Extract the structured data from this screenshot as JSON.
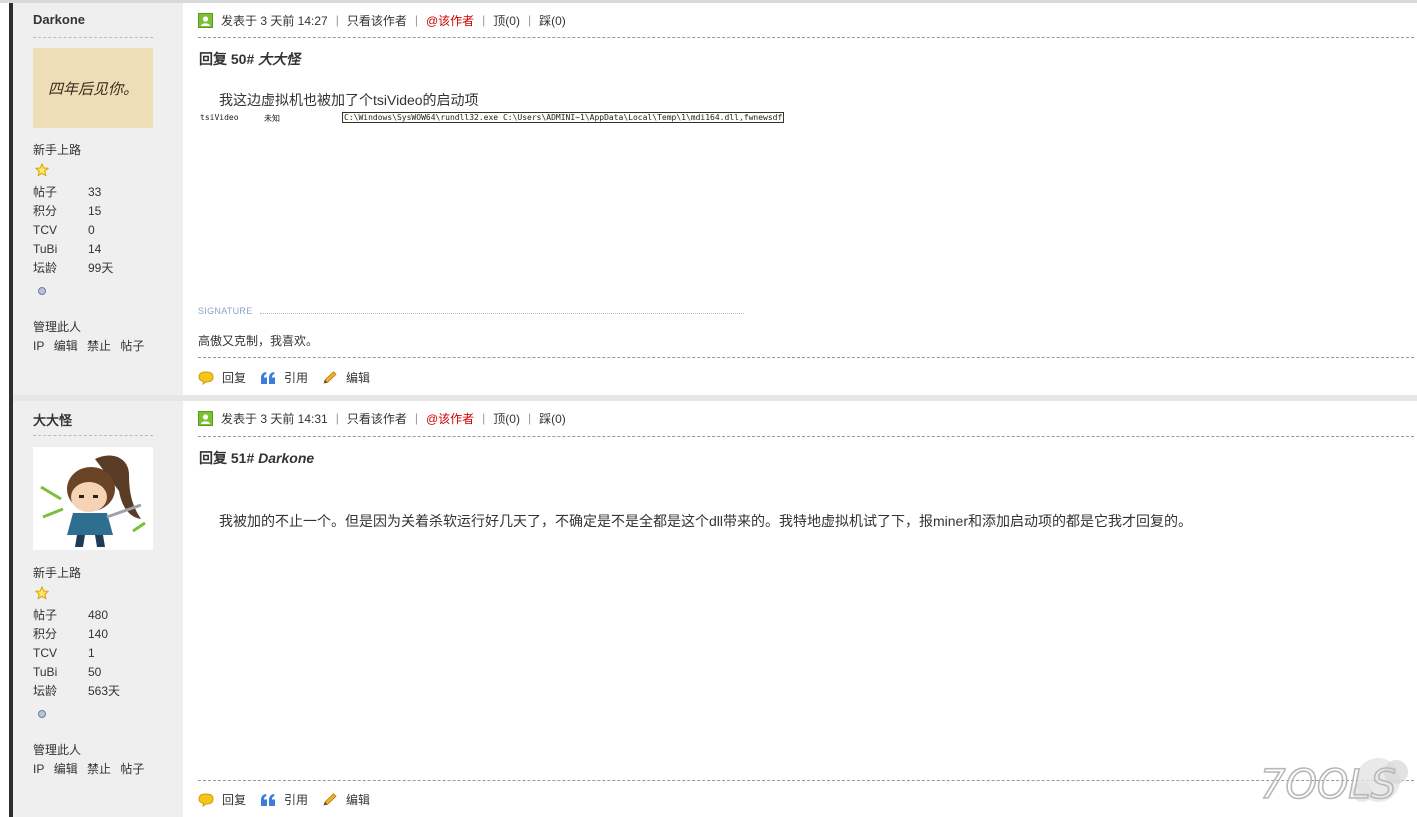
{
  "colors": {
    "sidebar_bg": "#efefef",
    "left_bar": "#2e2e2e",
    "red_link": "#cc0000",
    "signature_label": "#8aa4c8"
  },
  "posts": [
    {
      "author": "Darkone",
      "group": "新手上路",
      "stats": [
        {
          "k": "帖子",
          "v": "33"
        },
        {
          "k": "积分",
          "v": "15"
        },
        {
          "k": "TCV",
          "v": "0"
        },
        {
          "k": "TuBi",
          "v": "14"
        },
        {
          "k": "坛龄",
          "v": "99天"
        }
      ],
      "manage": "管理此人",
      "manage_links": [
        "IP",
        "编辑",
        "禁止",
        "帖子"
      ],
      "meta": {
        "posted": "发表于 3 天前 14:27",
        "only_author": "只看该作者",
        "at_author": "@该作者",
        "top": "顶(0)",
        "down": "踩(0)"
      },
      "title_prefix": "回复 50#",
      "title_user": "大大怪",
      "content": "我这边虚拟机也被加了个tsiVideo的启动项",
      "reg_entry": {
        "name": "tsiVideo",
        "publisher": "未知",
        "command": "C:\\Windows\\SysWOW64\\rundll32.exe C:\\Users\\ADMINI~1\\AppData\\Local\\Temp\\1\\mdi164.dll,fwnewsdf"
      },
      "signature_label": "SIGNATURE",
      "signature": "高傲又克制，我喜欢。",
      "avatar_text": "四年后见你。",
      "actions": [
        "回复",
        "引用",
        "编辑"
      ]
    },
    {
      "author": "大大怪",
      "group": "新手上路",
      "stats": [
        {
          "k": "帖子",
          "v": "480"
        },
        {
          "k": "积分",
          "v": "140"
        },
        {
          "k": "TCV",
          "v": "1"
        },
        {
          "k": "TuBi",
          "v": "50"
        },
        {
          "k": "坛龄",
          "v": "563天"
        }
      ],
      "manage": "管理此人",
      "manage_links": [
        "IP",
        "编辑",
        "禁止",
        "帖子"
      ],
      "meta": {
        "posted": "发表于 3 天前 14:31",
        "only_author": "只看该作者",
        "at_author": "@该作者",
        "top": "顶(0)",
        "down": "踩(0)"
      },
      "title_prefix": "回复 51#",
      "title_user": "Darkone",
      "content": "我被加的不止一个。但是因为关着杀软运行好几天了，不确定是不是全都是这个dll带来的。我特地虚拟机试了下，报miner和添加启动项的都是它我才回复的。",
      "actions": [
        "回复",
        "引用",
        "编辑"
      ]
    }
  ],
  "watermark": "7OOLS"
}
